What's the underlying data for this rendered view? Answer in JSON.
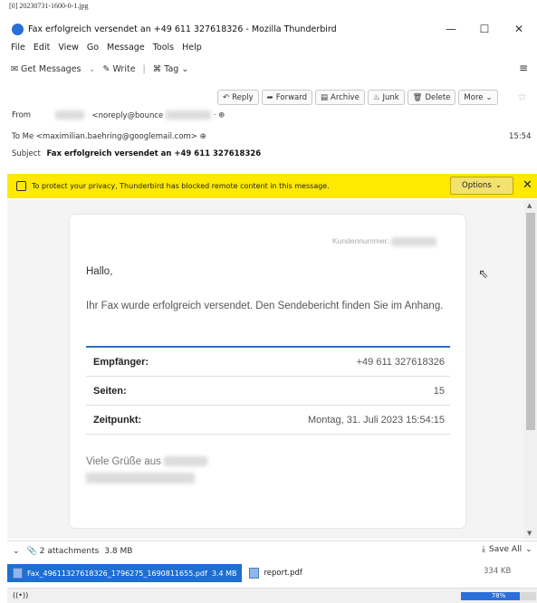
{
  "caption": "[0] 20230731-1600-0-1.jpg",
  "window": {
    "title": "Fax erfolgreich versendet an +49 611 327618326 - Mozilla Thunderbird",
    "minimize": "—",
    "maximize": "☐",
    "close": "✕"
  },
  "menu": [
    "File",
    "Edit",
    "View",
    "Go",
    "Message",
    "Tools",
    "Help"
  ],
  "toolbar": {
    "get_messages": "Get Messages",
    "write": "Write",
    "tag": "Tag"
  },
  "actions": {
    "reply": "Reply",
    "forward": "Forward",
    "archive": "Archive",
    "junk": "Junk",
    "delete": "Delete",
    "more": "More"
  },
  "headers": {
    "from_label": "From",
    "from_value": "<noreply@bounce",
    "to_label": "To",
    "to_value": "Me <maximilian.baehring@googlemail.com>",
    "subject_label": "Subject",
    "subject_value": "Fax erfolgreich versendet an +49 611 327618326",
    "time": "15:54"
  },
  "notice": {
    "text": "To protect your privacy, Thunderbird has blocked remote content in this message.",
    "options": "Options"
  },
  "email": {
    "kundennummer": "Kundennummer:",
    "greeting": "Hallo,",
    "body": "Ihr Fax wurde erfolgreich versendet. Den Sendebericht finden Sie im Anhang.",
    "details": [
      {
        "key": "Empfänger:",
        "value": "+49 611 327618326"
      },
      {
        "key": "Seiten:",
        "value": "15"
      },
      {
        "key": "Zeitpunkt:",
        "value": "Montag, 31. Juli 2023 15:54:15"
      }
    ],
    "closing": "Viele Grüße aus"
  },
  "attachments": {
    "summary": "2 attachments",
    "total_size": "3.8 MB",
    "save_all": "Save All",
    "files": [
      {
        "name": "Fax_49611327618326_1796275_1690811655.pdf",
        "size": "3.4 MB"
      },
      {
        "name": "report.pdf",
        "size": "334 KB"
      }
    ]
  },
  "status": {
    "progress_percent": 78,
    "progress_text": "78%"
  }
}
